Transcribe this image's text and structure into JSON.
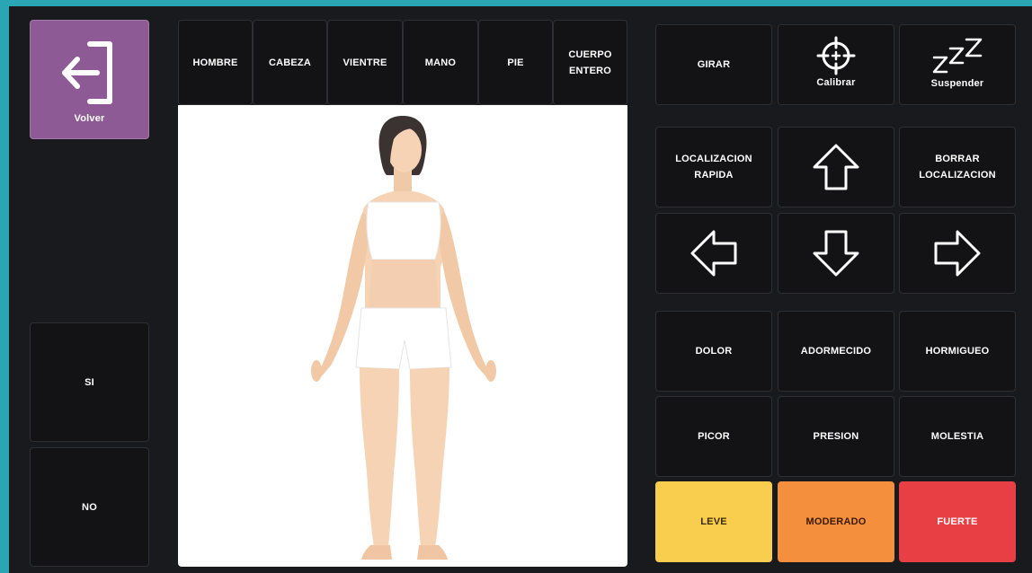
{
  "left": {
    "back_label": "Volver",
    "yes_label": "SI",
    "no_label": "NO"
  },
  "body_tabs": [
    "HOMBRE",
    "CABEZA",
    "VIENTRE",
    "MANO",
    "PIE",
    "CUERPO\nENTERO"
  ],
  "controls": {
    "rotate_label": "GIRAR",
    "calibrate_label": "Calibrar",
    "suspend_label": "Suspender",
    "quick_locate_label": "LOCALIZACION\nRAPIDA",
    "clear_locate_label": "BORRAR\nLOCALIZACION"
  },
  "sensations": [
    "DOLOR",
    "ADORMECIDO",
    "HORMIGUEO",
    "PICOR",
    "PRESION",
    "MOLESTIA"
  ],
  "intensity": {
    "mild": "LEVE",
    "moderate": "MODERADO",
    "strong": "FUERTE"
  },
  "icons": {
    "back": "exit-arrow-icon",
    "calibrate": "crosshair-icon",
    "suspend": "sleep-zzz-icon",
    "up": "arrow-up-icon",
    "down": "arrow-down-icon",
    "left": "arrow-left-icon",
    "right": "arrow-right-icon"
  },
  "colors": {
    "background": "#191a1d",
    "accent_border": "#2aa5b3",
    "back_button": "#8e5a96",
    "level_mild": "#f9cd4e",
    "level_moderate": "#f48f3d",
    "level_strong": "#e73f44"
  }
}
